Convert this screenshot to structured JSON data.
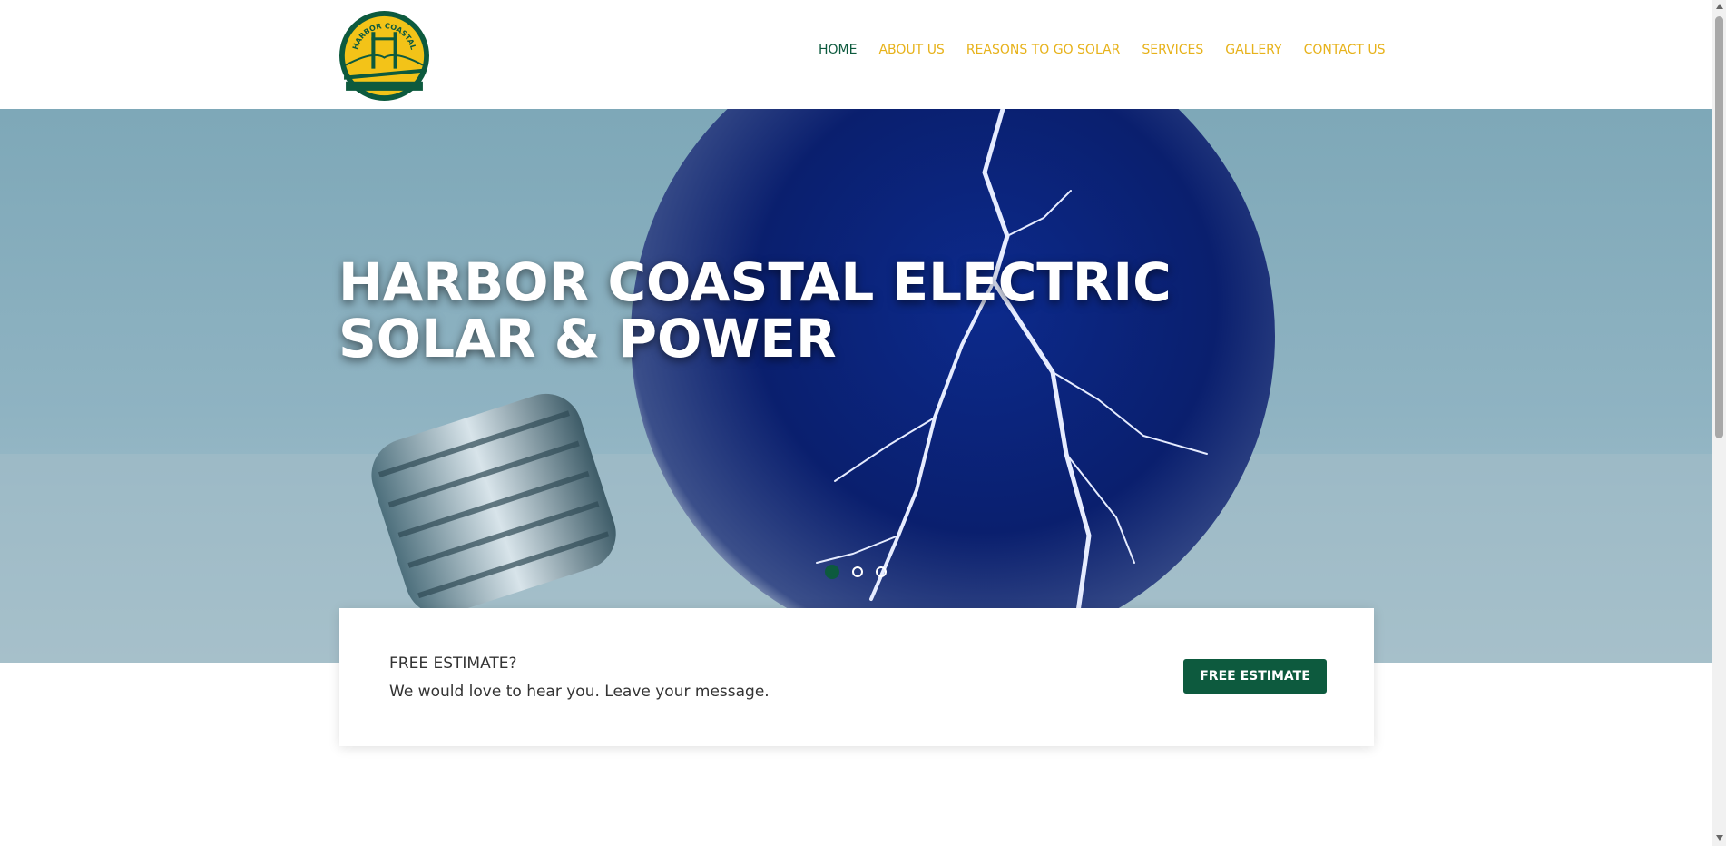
{
  "brand": {
    "logo_text": "HARBOR COASTAL",
    "colors": {
      "green": "#0d5a3e",
      "gold": "#e7b21a"
    }
  },
  "nav": {
    "items": [
      {
        "label": "HOME",
        "active": true
      },
      {
        "label": "ABOUT US",
        "active": false
      },
      {
        "label": "REASONS TO GO SOLAR",
        "active": false
      },
      {
        "label": "SERVICES",
        "active": false
      },
      {
        "label": "GALLERY",
        "active": false
      },
      {
        "label": "CONTACT US",
        "active": false
      }
    ]
  },
  "hero": {
    "title_line1": "HARBOR COASTAL ELECTRIC",
    "title_line2": "SOLAR & POWER",
    "slides": 3,
    "active_slide": 1
  },
  "cta": {
    "heading": "FREE ESTIMATE?",
    "text": "We would love to hear you. Leave your message.",
    "button_label": "FREE ESTIMATE"
  }
}
